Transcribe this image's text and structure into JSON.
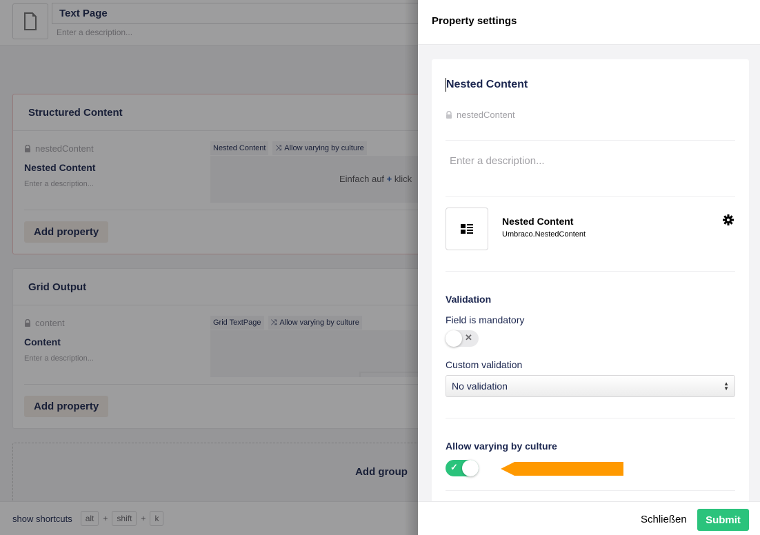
{
  "editor": {
    "doc_name": "Text Page",
    "doc_description_placeholder": "Enter a description...",
    "groups": [
      {
        "title": "Structured Content",
        "property": {
          "alias": "nestedContent",
          "label": "Nested Content",
          "description_placeholder": "Enter a description...",
          "editor_tag": "Nested Content",
          "culture_tag": "Allow varying by culture",
          "preview_hint_before": "Einfach auf",
          "preview_hint_after": "klick"
        },
        "add_property_label": "Add property"
      },
      {
        "title": "Grid Output",
        "property": {
          "alias": "content",
          "label": "Content",
          "description_placeholder": "Enter a description...",
          "editor_tag": "Grid TextPage",
          "culture_tag": "Allow varying by culture"
        },
        "add_property_label": "Add property"
      }
    ],
    "add_group_label": "Add group",
    "footer": {
      "shortcuts_label": "show shortcuts",
      "keys": [
        "alt",
        "shift",
        "k"
      ],
      "plus": "+"
    }
  },
  "panel": {
    "title": "Property settings",
    "property_name": "Nested Content",
    "property_alias": "nestedContent",
    "description_placeholder": "Enter a description...",
    "editor": {
      "name": "Nested Content",
      "alias": "Umbraco.NestedContent"
    },
    "validation": {
      "title": "Validation",
      "mandatory_label": "Field is mandatory",
      "mandatory_on": false,
      "custom_label": "Custom validation",
      "custom_value": "No validation"
    },
    "culture": {
      "title": "Allow varying by culture",
      "on": true
    },
    "buttons": {
      "close": "Schließen",
      "submit": "Submit"
    }
  },
  "colors": {
    "accent_green": "#2bc37c",
    "annotation_arrow": "#ff9900",
    "primary_text": "#1b264f"
  }
}
